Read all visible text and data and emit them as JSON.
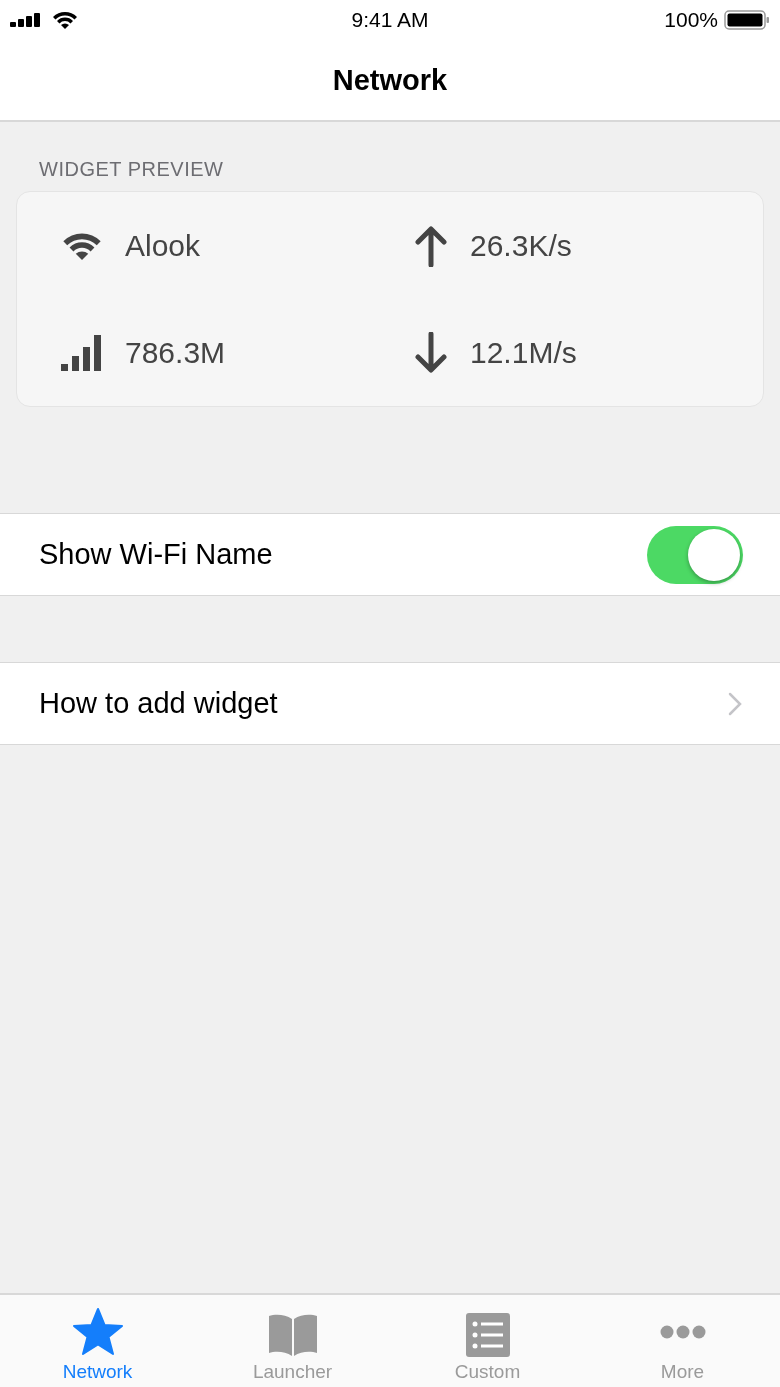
{
  "status_bar": {
    "time": "9:41 AM",
    "battery": "100%"
  },
  "nav_bar": {
    "title": "Network"
  },
  "widget_preview": {
    "header": "WIDGET PREVIEW",
    "items": [
      {
        "kind": "wifi",
        "value": "Alook"
      },
      {
        "kind": "upload",
        "value": "26.3K/s"
      },
      {
        "kind": "signal",
        "value": "786.3M"
      },
      {
        "kind": "download",
        "value": "12.1M/s"
      }
    ]
  },
  "settings": [
    {
      "kind": "toggle",
      "label": "Show Wi-Fi Name",
      "on": true
    },
    {
      "kind": "link",
      "label": "How to add widget"
    }
  ],
  "tab_bar": [
    {
      "kind": "star",
      "label": "Network",
      "selected": true
    },
    {
      "kind": "book",
      "label": "Launcher",
      "selected": false
    },
    {
      "kind": "list",
      "label": "Custom",
      "selected": false
    },
    {
      "kind": "dots",
      "label": "More",
      "selected": false
    }
  ]
}
